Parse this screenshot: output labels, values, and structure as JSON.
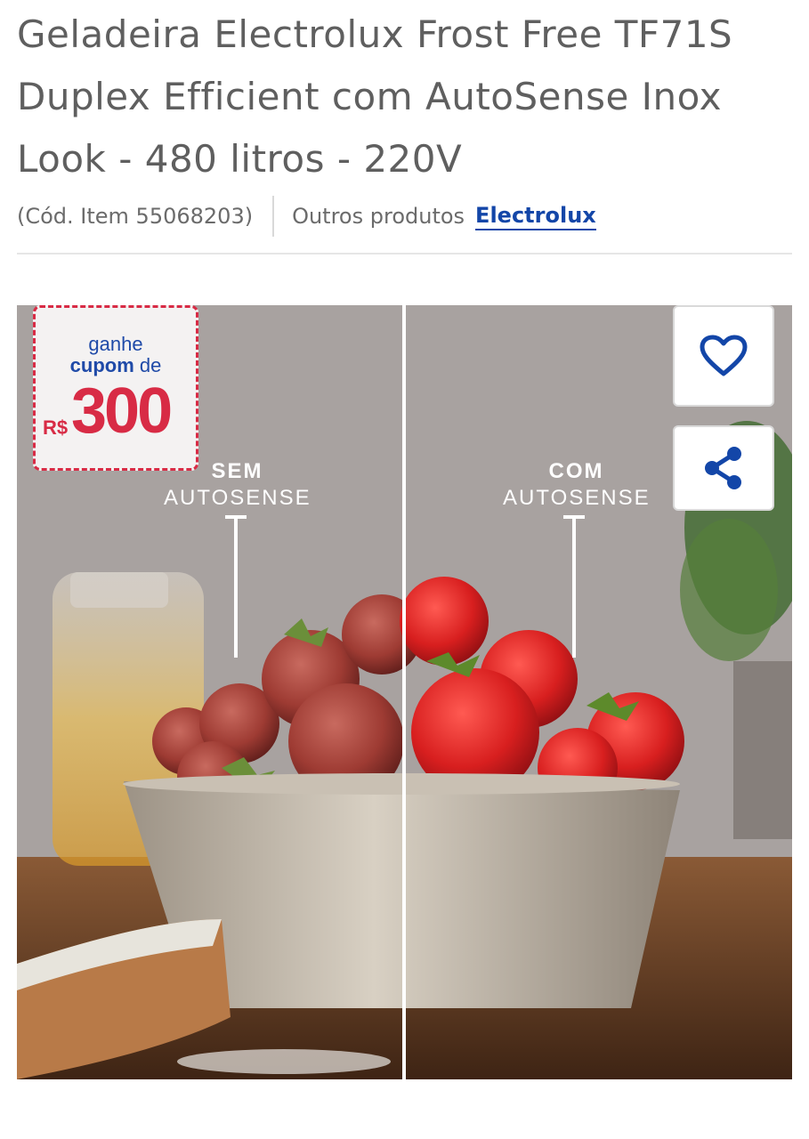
{
  "product": {
    "title": "Geladeira Electrolux Frost Free TF71S Duplex Efficient com AutoSense Inox Look - 480 litros - 220V",
    "item_code": "(Cód. Item 55068203)",
    "other_products_label": "Outros produtos",
    "brand": "Electrolux"
  },
  "coupon": {
    "line1": "ganhe",
    "line2_bold": "cupom",
    "line2_rest": " de",
    "currency": "R$",
    "amount": "300"
  },
  "comparison": {
    "left_line1": "SEM",
    "left_line2": "AUTOSENSE",
    "right_line1": "COM",
    "right_line2": "AUTOSENSE"
  },
  "actions": {
    "favorite_icon": "heart-icon",
    "share_icon": "share-icon"
  },
  "colors": {
    "brand_blue": "#1346a8",
    "coupon_red": "#d82b45",
    "title_gray": "#5f5f5f"
  }
}
